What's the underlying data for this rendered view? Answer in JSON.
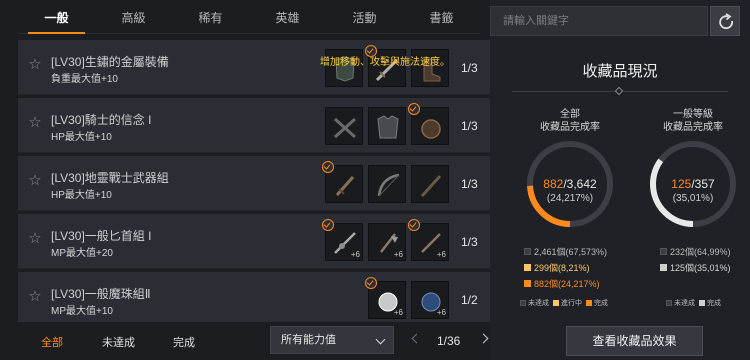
{
  "tabs": [
    {
      "label": "一般",
      "active": true
    },
    {
      "label": "高級",
      "active": false
    },
    {
      "label": "稀有",
      "active": false
    },
    {
      "label": "英雄",
      "active": false
    },
    {
      "label": "活動",
      "active": false
    },
    {
      "label": "書籤",
      "active": false
    }
  ],
  "tooltip": "增加移動、攻擊與施法速度。",
  "rows": [
    {
      "title": "[LV30]生鏽的金屬裝備",
      "sub": "負重最大值+10",
      "count": "1/3",
      "slots": [
        {
          "icon": "armor-icon",
          "check": false,
          "plus": ""
        },
        {
          "icon": "sword-icon",
          "check": true,
          "plus": ""
        },
        {
          "icon": "boots-icon",
          "check": false,
          "plus": ""
        }
      ]
    },
    {
      "title": "[LV30]騎士的信念 I",
      "sub": "HP最大值+10",
      "count": "1/3",
      "slots": [
        {
          "icon": "crossbow-icon",
          "check": false,
          "plus": ""
        },
        {
          "icon": "chest-armor-icon",
          "check": false,
          "plus": ""
        },
        {
          "icon": "gloves-icon",
          "check": true,
          "plus": ""
        }
      ]
    },
    {
      "title": "[LV30]地靈戰士武器組",
      "sub": "HP最大值+10",
      "count": "1/3",
      "slots": [
        {
          "icon": "dagger-icon",
          "check": true,
          "plus": ""
        },
        {
          "icon": "bow-icon",
          "check": false,
          "plus": ""
        },
        {
          "icon": "staff-icon",
          "check": false,
          "plus": ""
        }
      ]
    },
    {
      "title": "[LV30]一般匕首組 I",
      "sub": "MP最大值+20",
      "count": "1/3",
      "slots": [
        {
          "icon": "spear-icon",
          "check": true,
          "plus": "+6"
        },
        {
          "icon": "axe-icon",
          "check": false,
          "plus": "+6"
        },
        {
          "icon": "knife-icon",
          "check": true,
          "plus": "+6"
        }
      ]
    },
    {
      "title": "[LV30]一般魔珠組Ⅱ",
      "sub": "MP最大值+10",
      "count": "1/2",
      "slots": [
        {
          "icon": "orb-icon",
          "check": true,
          "plus": "+6"
        },
        {
          "icon": "helmet-icon",
          "check": false,
          "plus": "+6"
        }
      ]
    }
  ],
  "filters": {
    "all": "全部",
    "incomplete": "未達成",
    "complete": "完成"
  },
  "ability_select": "所有能力值",
  "pager": {
    "text": "1/36",
    "current": 1,
    "total": 36
  },
  "search": {
    "placeholder": "請輸入關鍵字"
  },
  "panel": {
    "title": "收藏品現況",
    "all": {
      "label_line1": "全部",
      "label_line2": "收藏品完成率",
      "done": "882",
      "total": "3,642",
      "pct": "(24,217%)",
      "progress": 0.2422,
      "stats": [
        {
          "text": "2,461個(67,573%)",
          "color": "#3a3d42"
        },
        {
          "text": "299個(8,21%)",
          "color": "#ffc766"
        },
        {
          "text": "882個(24,217%)",
          "color": "#ff8a1c"
        }
      ],
      "legend": [
        "未達成",
        "進行中",
        "完成"
      ]
    },
    "normal": {
      "label_line1": "一般等級",
      "label_line2": "收藏品完成率",
      "done": "125",
      "total": "357",
      "pct": "(35,01%)",
      "progress": 0.3501,
      "stats": [
        {
          "text": "232個(64,99%)",
          "color": "#3a3d42"
        },
        {
          "text": "125個(35,01%)",
          "color": "#cfcfcf"
        }
      ],
      "legend": [
        "未達成",
        "完成"
      ]
    },
    "button": "查看收藏品效果"
  },
  "colors": {
    "accent": "#ff8a1c",
    "accent_light": "#ffc766",
    "gauge_track": "#3c3f45",
    "white_gauge": "#e8e8e8"
  }
}
